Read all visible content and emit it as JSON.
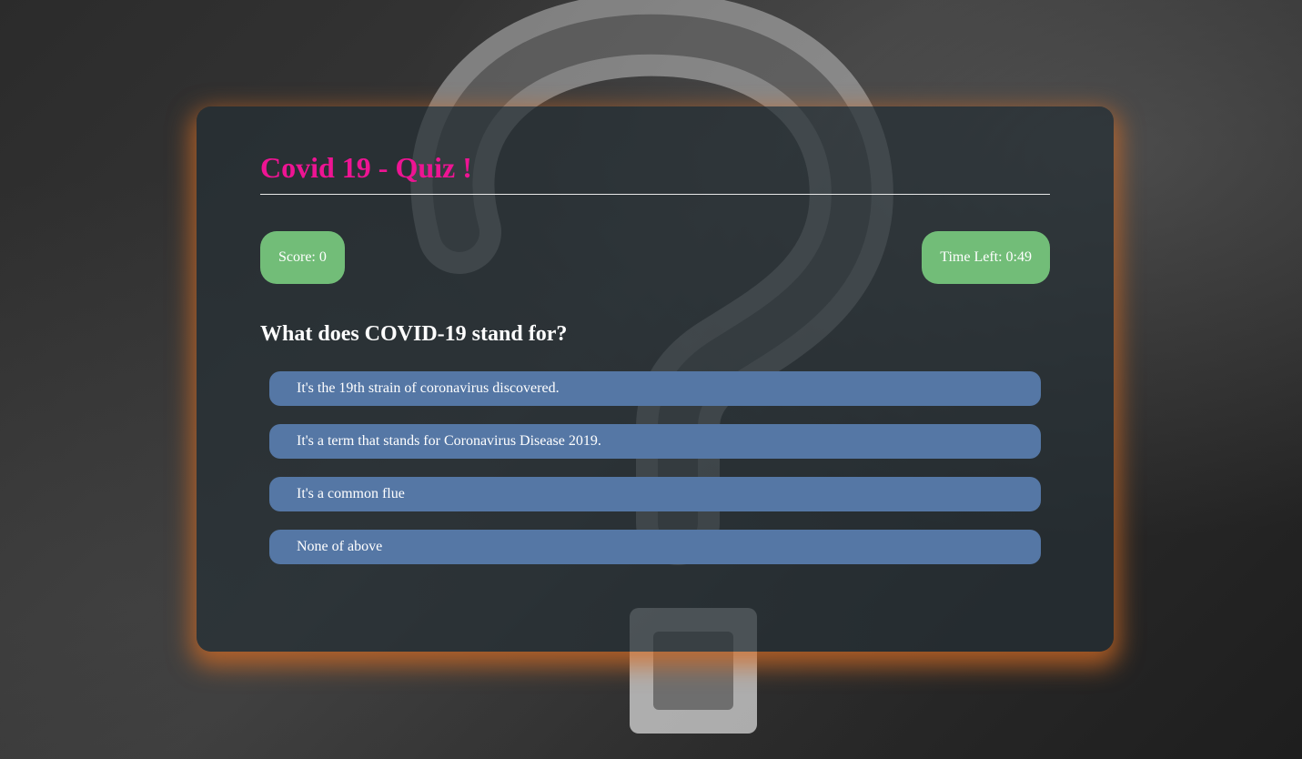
{
  "quiz": {
    "title": "Covid 19 - Quiz !",
    "score_text": "Score: 0",
    "timer_text": "Time Left: 0:49"
  },
  "question": {
    "text": "What does COVID-19 stand for?",
    "answers": [
      "It's the 19th strain of coronavirus discovered.",
      "It's a term that stands for Coronavirus Disease 2019.",
      "It's a common flue",
      "None of above"
    ]
  },
  "colors": {
    "title": "#ee1493",
    "pill": "#72bd78",
    "answer": "#5577a5",
    "glow": "#d66c24"
  }
}
